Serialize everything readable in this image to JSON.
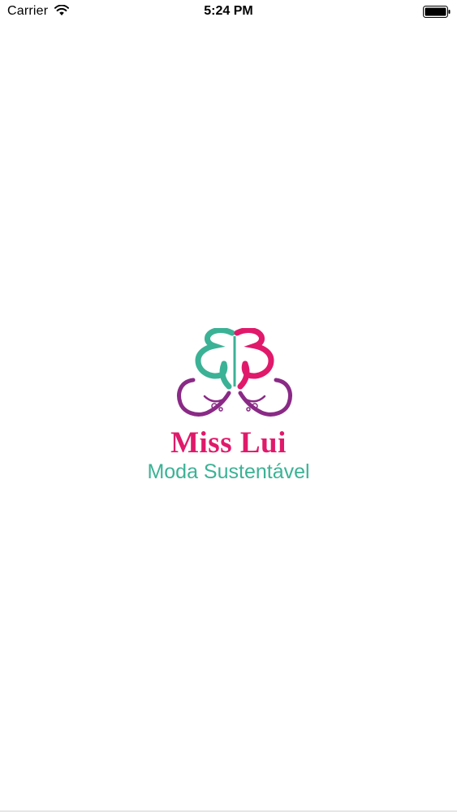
{
  "status_bar": {
    "carrier": "Carrier",
    "time": "5:24 PM",
    "wifi_icon": "wifi-icon",
    "battery_icon": "battery-icon"
  },
  "splash": {
    "brand_name": "Miss Lui",
    "tagline": "Moda Sustentável",
    "logo_icon": "butterfly-logo-icon",
    "colors": {
      "brand_pink": "#e0196b",
      "brand_teal": "#3bb295",
      "brand_purple": "#8a2a86"
    }
  }
}
